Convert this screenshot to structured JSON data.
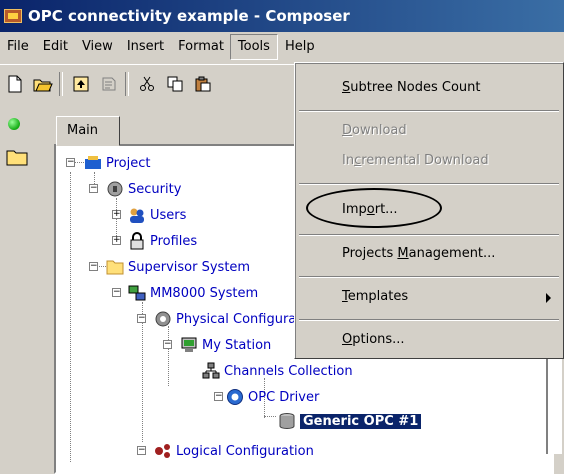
{
  "window": {
    "title": "OPC connectivity example - Composer"
  },
  "menubar": {
    "items": [
      "File",
      "Edit",
      "View",
      "Insert",
      "Format",
      "Tools",
      "Help"
    ],
    "active": "Tools"
  },
  "toolbar": {
    "buttons": [
      "new-icon",
      "open-icon",
      "up-icon",
      "properties-icon",
      "cut-icon",
      "copy-icon",
      "paste-icon"
    ]
  },
  "tabs": {
    "main": "Main"
  },
  "tree": {
    "project": "Project",
    "security": "Security",
    "users": "Users",
    "profiles": "Profiles",
    "supervisor": "Supervisor System",
    "mm8000": "MM8000 System",
    "physical": "Physical Configuration",
    "mystation": "My Station",
    "channels": "Channels Collection",
    "opcdriver": "OPC Driver",
    "genericopc": "Generic OPC #1",
    "logical": "Logical Configuration"
  },
  "tools_menu": {
    "subtree": {
      "pre": "",
      "u": "S",
      "post": "ubtree Nodes Count"
    },
    "download": {
      "pre": "",
      "u": "D",
      "post": "ownload"
    },
    "incremental": {
      "pre": "In",
      "u": "c",
      "post": "remental Download"
    },
    "import": {
      "pre": "Imp",
      "u": "o",
      "post": "rt..."
    },
    "projects": {
      "pre": "Projects ",
      "u": "M",
      "post": "anagement..."
    },
    "templates": {
      "pre": "",
      "u": "T",
      "post": "emplates"
    },
    "options": {
      "pre": "",
      "u": "O",
      "post": "ptions..."
    }
  },
  "colors": {
    "title_bar": "#0a246a",
    "selection": "#0a246a",
    "tree_text": "#0000c0",
    "menu_bg": "#d4d0c8"
  }
}
